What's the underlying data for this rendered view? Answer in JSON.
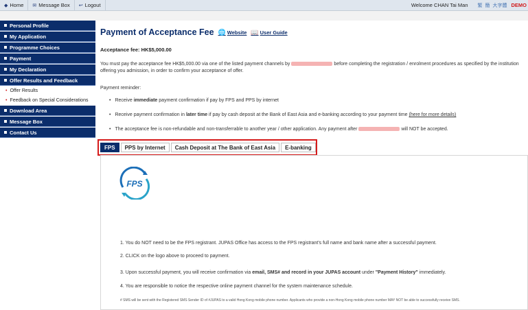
{
  "topbar": {
    "home": "Home",
    "message_box": "Message Box",
    "logout": "Logout",
    "welcome": "Welcome CHAN Tai Man",
    "languages": [
      "繁",
      "簡",
      "大字體"
    ],
    "demo": "DEMO"
  },
  "sidebar": {
    "items": [
      {
        "label": "Personal Profile"
      },
      {
        "label": "My Application"
      },
      {
        "label": "Programme Choices"
      },
      {
        "label": "Payment"
      },
      {
        "label": "My Declaration"
      },
      {
        "label": "Offer Results and Feedback"
      }
    ],
    "subitems": [
      {
        "label": "Offer Results"
      },
      {
        "label": "Feedback on Special Considerations"
      }
    ],
    "items_after": [
      {
        "label": "Download Area"
      },
      {
        "label": "Message Box"
      },
      {
        "label": "Contact Us"
      }
    ]
  },
  "main": {
    "title": "Payment of Acceptance Fee",
    "website_link": "Website",
    "user_guide_link": "User Guide",
    "fee_line": "Acceptance fee: HK$5,000.00",
    "para_before": "You must pay the acceptance fee HK$5,000.00 via one of the listed payment channels by",
    "para_after": "before completing the registration / enrolment procedures as specified by the institution offering you admission, in order to confirm your acceptance of offer.",
    "reminder_label": "Payment reminder:",
    "bullet1_pre": "Receive",
    "bullet1_bold": "immediate",
    "bullet1_post": "payment confirmation if pay by FPS and PPS by internet",
    "bullet2_pre": "Receive payment confirmation in",
    "bullet2_bold": "later time",
    "bullet2_post": "if pay by cash deposit at the Bank of East Asia and e-banking according to your payment time",
    "bullet2_link": "(here for more details)",
    "bullet3_pre": "The acceptance fee is non-refundable and non-transferrable to another year / other application. Any payment after",
    "bullet3_post": "will NOT be accepted."
  },
  "tabs": [
    "FPS",
    "PPS by Internet",
    "Cash Deposit at The Bank of East Asia",
    "E-banking"
  ],
  "fps_panel": {
    "logo_text": "FPS",
    "step1": "1. You do NOT need to be the FPS registrant. JUPAS Office has access to the FPS registrant's full name and bank name after a successful payment.",
    "step2": "2. CLICK on the logo above to proceed to payment.",
    "step3_pre": "3. Upon successful payment, you will receive confirmation via",
    "step3_bold": "email, SMS# and record in your JUPAS account",
    "step3_mid": "under",
    "step3_bold2": "\"Payment History\"",
    "step3_post": "immediately.",
    "step4": "4. You are responsible to notice the respective online payment channel for the system maintenance schedule.",
    "footnote": "# SMS will be sent with the Registered SMS Sender ID of #JUPAS to a valid Hong Kong mobile phone number. Applicants who provide a non-Hong Kong mobile phone number MAY NOT be able to successfully receive SMS."
  },
  "colors": {
    "nav_blue": "#0b2d6b",
    "highlight_red": "#d51a1a",
    "demo_red": "#d11a1a"
  }
}
